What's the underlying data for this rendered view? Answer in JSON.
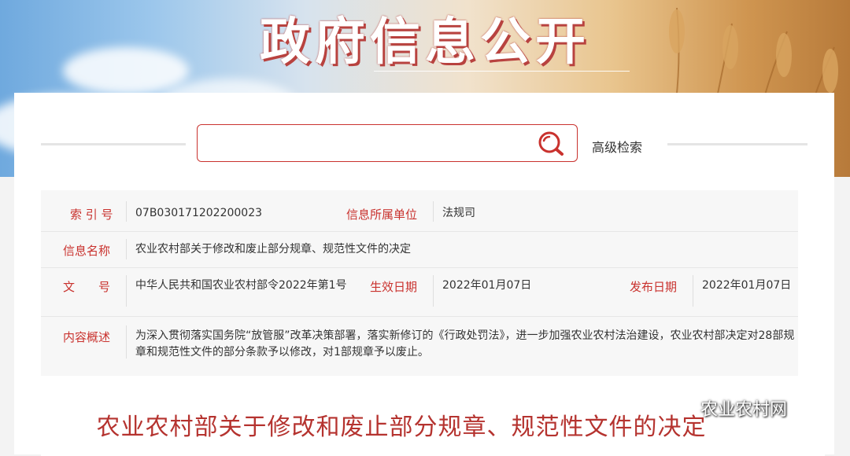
{
  "banner": {
    "title": "政府信息公开"
  },
  "search": {
    "value": "",
    "placeholder": "",
    "advanced_label": "高级检索"
  },
  "meta": {
    "index_label": "索 引 号",
    "index_value": "07B030171202200023",
    "unit_label": "信息所属单位",
    "unit_value": "法规司",
    "name_label": "信息名称",
    "name_value": "农业农村部关于修改和废止部分规章、规范性文件的决定",
    "doc_no_label": "文　　号",
    "doc_no_value": "中华人民共和国农业农村部令2022年第1号",
    "effective_label": "生效日期",
    "effective_value": "2022年01月07日",
    "publish_label": "发布日期",
    "publish_value": "2022年01月07日",
    "summary_label": "内容概述",
    "summary_value": "为深入贯彻落实国务院“放管服”改革决策部署，落实新修订的《行政处罚法》，进一步加强农业农村法治建设，农业农村部决定对28部规章和规范性文件的部分条款予以修改，对1部规章予以废止。"
  },
  "document": {
    "title": "农业农村部关于修改和废止部分规章、规范性文件的决定"
  },
  "watermark": {
    "text": "农业农村网",
    "icon": "wechat-icon"
  },
  "colors": {
    "accent": "#c9322e",
    "title_red": "#b5332f"
  }
}
